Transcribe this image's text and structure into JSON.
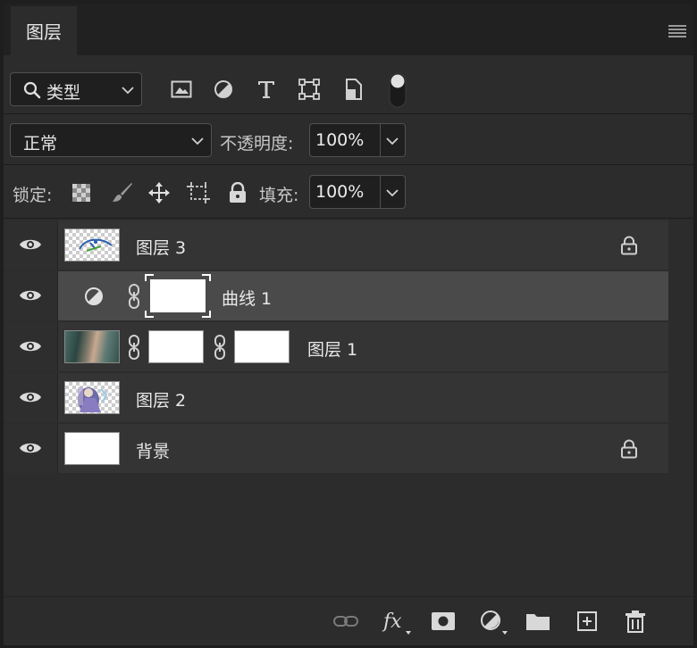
{
  "panel": {
    "tab_title": "图层",
    "menu_icon": "hamburger-menu-icon"
  },
  "filter": {
    "kind_label": "类型",
    "icons": [
      "image-filter-icon",
      "adjustment-filter-icon",
      "type-filter-icon",
      "shape-filter-icon",
      "smart-object-filter-icon",
      "filter-toggle-icon"
    ]
  },
  "blend": {
    "mode": "正常",
    "opacity_label": "不透明度:",
    "opacity_value": "100%"
  },
  "lock": {
    "label": "锁定:",
    "fill_label": "填充:",
    "fill_value": "100%"
  },
  "layers": [
    {
      "name": "图层 3",
      "locked": true,
      "selected": false
    },
    {
      "name": "曲线 1",
      "locked": false,
      "selected": true
    },
    {
      "name": "图层 1",
      "locked": false,
      "selected": false
    },
    {
      "name": "图层 2",
      "locked": false,
      "selected": false
    },
    {
      "name": "背景",
      "locked": true,
      "selected": false
    }
  ],
  "bottom_icons": [
    "link-layers-icon",
    "fx-icon",
    "add-mask-icon",
    "new-adjustment-icon",
    "new-group-icon",
    "new-layer-icon",
    "delete-icon"
  ],
  "colors": {
    "panel_bg": "#2c2c2c",
    "selected_row": "#4a4a4a",
    "row_bg": "#343434"
  }
}
